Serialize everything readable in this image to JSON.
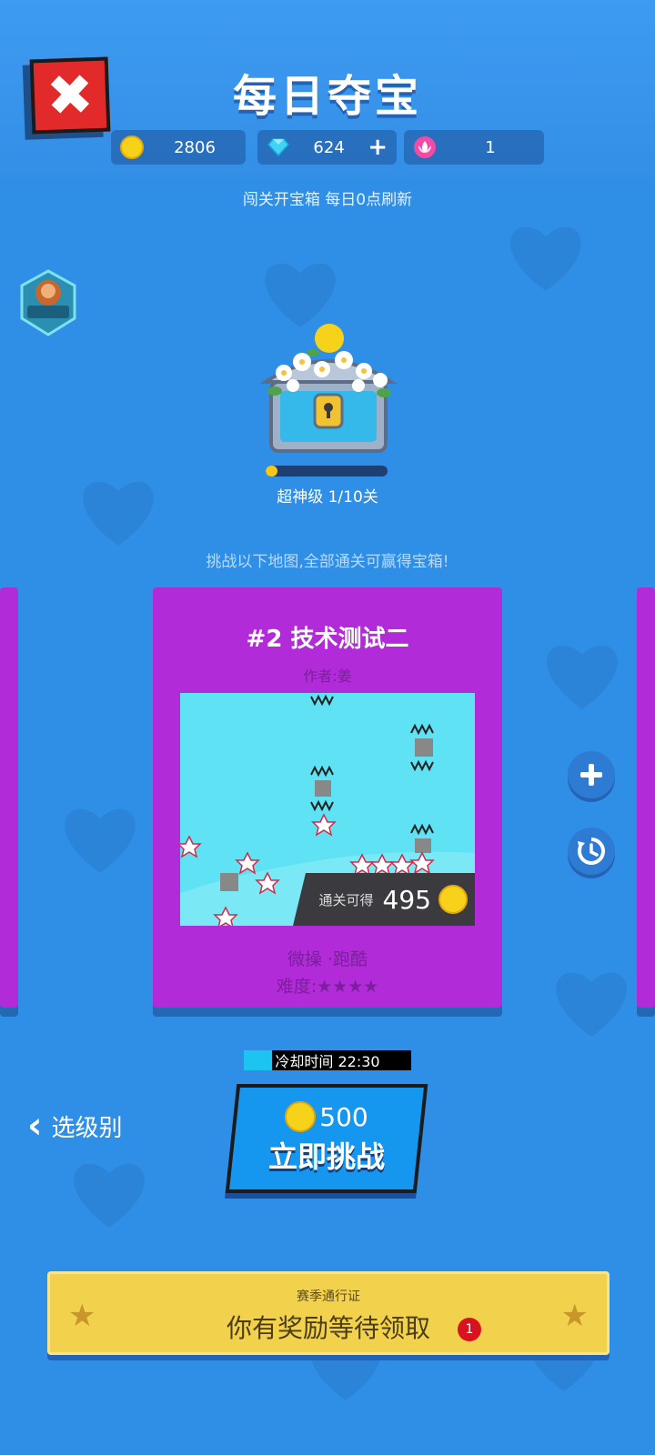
{
  "header": {
    "title": "每日夺宝",
    "close_icon": "close-icon"
  },
  "currencies": [
    {
      "icon": "coin-icon",
      "value": "2806"
    },
    {
      "icon": "diamond-icon",
      "value": "624",
      "action": "+"
    },
    {
      "icon": "lotus-icon",
      "value": "1"
    }
  ],
  "subtitle": "闯关开宝箱 每日0点刷新",
  "treasure": {
    "level_text": "超神级 1/10关",
    "progress": 0.1
  },
  "hint": "挑战以下地图,全部通关可赢得宝箱!",
  "level_card": {
    "title": "#2 技术测试二",
    "author": "作者:姜",
    "reward_label": "通关可得",
    "reward_value": "495",
    "tags": "微操 ·跑酷",
    "difficulty": "难度:★★★★"
  },
  "side_buttons": [
    "plus-icon",
    "history-icon"
  ],
  "cooldown": {
    "text": "冷却时间 22:30",
    "progress": 0.17
  },
  "back": {
    "label": "选级别"
  },
  "challenge": {
    "cost": "500",
    "label": "立即挑战"
  },
  "season_pass": {
    "title": "赛季通行证",
    "message": "你有奖励等待领取",
    "badge": "1"
  },
  "colors": {
    "background": "#2f8fe6",
    "card": "#b12bd8",
    "gold": "#f7d21a",
    "close": "#e22a2a",
    "pass": "#f2d24c"
  }
}
